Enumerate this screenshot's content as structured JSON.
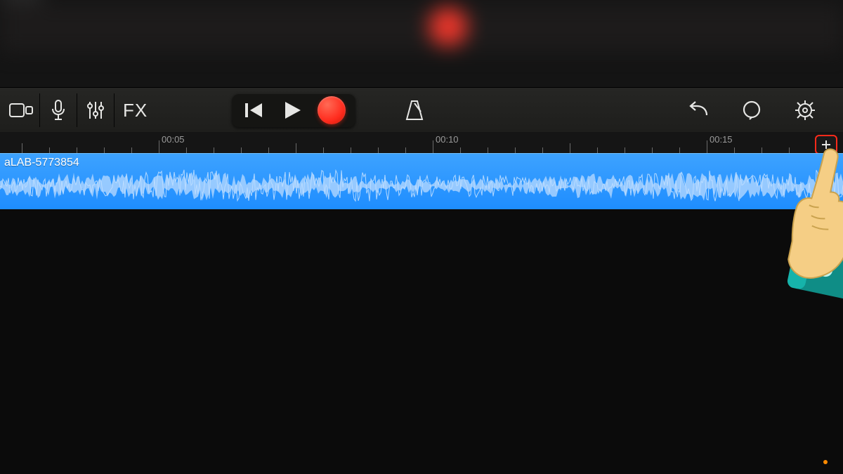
{
  "toolbar": {
    "tracks_icon": "tracks-icon",
    "mic_icon": "microphone-icon",
    "controls_icon": "track-controls-icon",
    "fx_label": "FX",
    "rewind_icon": "go-to-beginning-icon",
    "play_icon": "play-icon",
    "record_icon": "record-icon",
    "metronome_icon": "metronome-icon",
    "undo_icon": "undo-icon",
    "loop_icon": "loop-browser-icon",
    "settings_icon": "settings-icon"
  },
  "ruler": {
    "marks": [
      {
        "pos": 226,
        "label": "00:05"
      },
      {
        "pos": 616,
        "label": "00:10"
      },
      {
        "pos": 1006,
        "label": "00:15"
      }
    ],
    "add_label": "+"
  },
  "track": {
    "region_name": "aLAB-5773854"
  },
  "colors": {
    "record": "#ff2c1e",
    "region": "#2a93ff",
    "highlight": "#ff2a1a"
  }
}
